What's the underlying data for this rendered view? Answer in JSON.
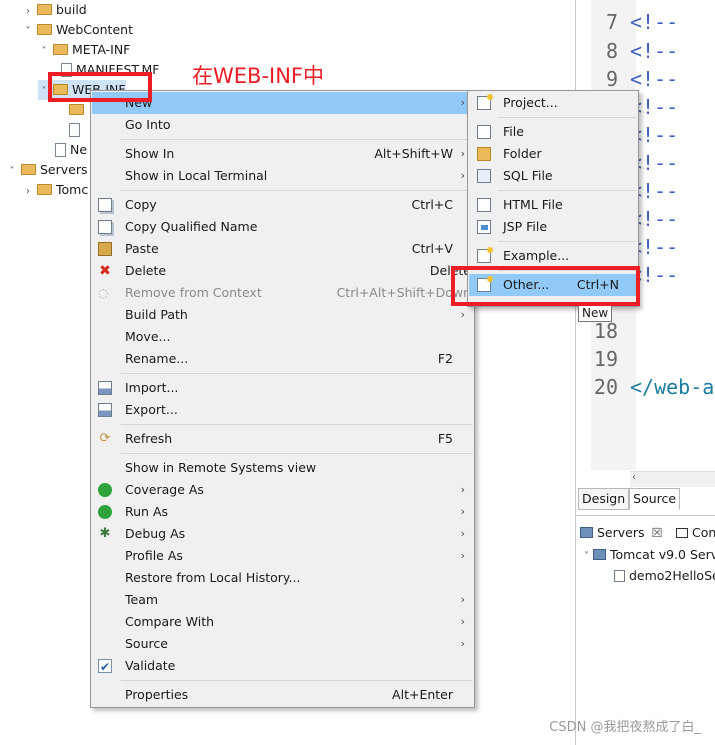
{
  "tree": {
    "items": [
      {
        "label": "build",
        "kind": "folder"
      },
      {
        "label": "WebContent",
        "kind": "folder"
      },
      {
        "label": "META-INF",
        "kind": "folder"
      },
      {
        "label": "MANIFEST.MF",
        "kind": "file"
      },
      {
        "label": "WEB-INF",
        "kind": "folder"
      },
      {
        "label": "Ne",
        "kind": "file"
      },
      {
        "label": "Servers",
        "kind": "folder"
      },
      {
        "label": "Tomc",
        "kind": "folder"
      }
    ]
  },
  "editor": {
    "line_numbers": [
      "7",
      "8",
      "9",
      "18",
      "19",
      "20"
    ],
    "code_lines": [
      "<!--",
      "<!--",
      "<!--",
      "<!--",
      "<!--",
      "<!--",
      "<!--",
      "<!--",
      "<!--",
      "<!--"
    ],
    "closing_tag": "</web-a",
    "tabs": [
      "Design",
      "Source"
    ]
  },
  "servers_view": {
    "tab_label": "Servers",
    "tab2_label": "Con",
    "server_label": "Tomcat v9.0 Serv",
    "module_label": "demo2HelloSe"
  },
  "context_menu": {
    "items": [
      {
        "label": "New",
        "shortcut": "",
        "submenu": true,
        "highlight": true
      },
      {
        "label": "Go Into",
        "shortcut": ""
      },
      {
        "label": "Show In",
        "shortcut": "Alt+Shift+W",
        "submenu": true
      },
      {
        "label": "Show in Local Terminal",
        "shortcut": "",
        "submenu": true
      },
      {
        "label": "Copy",
        "shortcut": "Ctrl+C"
      },
      {
        "label": "Copy Qualified Name",
        "shortcut": ""
      },
      {
        "label": "Paste",
        "shortcut": "Ctrl+V"
      },
      {
        "label": "Delete",
        "shortcut": "Delete"
      },
      {
        "label": "Remove from Context",
        "shortcut": "Ctrl+Alt+Shift+Down",
        "disabled": true
      },
      {
        "label": "Build Path",
        "shortcut": "",
        "submenu": true
      },
      {
        "label": "Move...",
        "shortcut": ""
      },
      {
        "label": "Rename...",
        "shortcut": "F2"
      },
      {
        "label": "Import...",
        "shortcut": ""
      },
      {
        "label": "Export...",
        "shortcut": ""
      },
      {
        "label": "Refresh",
        "shortcut": "F5"
      },
      {
        "label": "Show in Remote Systems view",
        "shortcut": ""
      },
      {
        "label": "Coverage As",
        "shortcut": "",
        "submenu": true
      },
      {
        "label": "Run As",
        "shortcut": "",
        "submenu": true
      },
      {
        "label": "Debug As",
        "shortcut": "",
        "submenu": true
      },
      {
        "label": "Profile As",
        "shortcut": "",
        "submenu": true
      },
      {
        "label": "Restore from Local History...",
        "shortcut": ""
      },
      {
        "label": "Team",
        "shortcut": "",
        "submenu": true
      },
      {
        "label": "Compare With",
        "shortcut": "",
        "submenu": true
      },
      {
        "label": "Source",
        "shortcut": "",
        "submenu": true
      },
      {
        "label": "Validate",
        "shortcut": ""
      },
      {
        "label": "Properties",
        "shortcut": "Alt+Enter"
      }
    ]
  },
  "new_submenu": {
    "items": [
      {
        "label": "Project...",
        "shortcut": ""
      },
      {
        "label": "File",
        "shortcut": ""
      },
      {
        "label": "Folder",
        "shortcut": ""
      },
      {
        "label": "SQL File",
        "shortcut": ""
      },
      {
        "label": "HTML File",
        "shortcut": ""
      },
      {
        "label": "JSP File",
        "shortcut": ""
      },
      {
        "label": "Example...",
        "shortcut": ""
      },
      {
        "label": "Other...",
        "shortcut": "Ctrl+N",
        "highlight": true
      }
    ]
  },
  "annotation": {
    "text": "在WEB-INF中",
    "color": "#ee1c25"
  },
  "tooltip": "New",
  "watermark": "CSDN @我把夜熬成了白_",
  "colors": {
    "menu_highlight": "#91c9f7",
    "menu_bg": "#f0f0f0",
    "annotation_red": "#ee1c25"
  }
}
